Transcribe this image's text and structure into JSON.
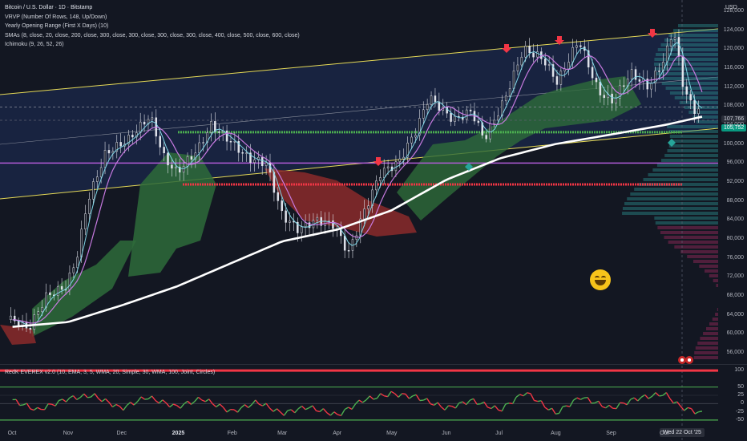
{
  "legend": {
    "title": "Bitcoin / U.S. Dollar · 1D · Bitstamp",
    "vrvp": "VRVP (Number Of Rows, 148, Up/Down)",
    "yearly": "Yearly Opening Range (First X Days) (10)",
    "smas": "SMAs (8, close, 20, close, 200, close, 300, close, 300, close, 300, close, 300, close, 400, close, 500, close, 600, close)",
    "ichimoku": "Ichimoku (9, 26, 52, 26)"
  },
  "currency": "USD",
  "oscillator_legend": "RedK EVEREX v2.0 (10, EMA, 3, 5, WMA, 20, Simple, 30, WMA, 100, Joint, Circles)",
  "price_tags": [
    {
      "value": "107,766",
      "color": "#d1d4dc",
      "bg": "#2a2e39"
    },
    {
      "value": "105,752",
      "color": "#ffffff",
      "bg": "#089981"
    }
  ],
  "date_tag": "Wed 22 Oct '25",
  "x_axis_note": "Nov",
  "colors": {
    "up": "#e0e3eb",
    "down": "#e0e3eb",
    "sma8": "#7fd6e6",
    "sma20": "#c77ae0",
    "sma200": "#ffffff",
    "channel": "#e5d957",
    "cloud_bull": "#2e6b3a",
    "cloud_bear": "#8b2a2a",
    "level_green": "#4caf50",
    "level_red": "#f23645",
    "level_purple": "#b05ad6",
    "osc_line": "#4caf50",
    "osc_red": "#f23645"
  },
  "chart_data": [
    {
      "type": "line",
      "title": "Bitcoin / U.S. Dollar · 1D · Bitstamp",
      "xlabel": "",
      "ylabel": "USD",
      "x_ticks": [
        "Oct",
        "Nov",
        "Dec",
        "2025",
        "Feb",
        "Mar",
        "Apr",
        "May",
        "Jun",
        "Jul",
        "Aug",
        "Sep",
        "Oct"
      ],
      "y_ticks": [
        56000,
        60000,
        64000,
        68000,
        72000,
        76000,
        80000,
        84000,
        88000,
        92000,
        96000,
        100000,
        104000,
        108000,
        112000,
        116000,
        120000,
        124000,
        128000
      ],
      "ylim": [
        54000,
        130000
      ],
      "series": [
        {
          "x": [
            "2024-10-01",
            "2024-10-10",
            "2024-10-20",
            "2024-10-31",
            "2024-11-06",
            "2024-11-12",
            "2024-11-22",
            "2024-12-05",
            "2024-12-17",
            "2024-12-25",
            "2025-01-01",
            "2025-01-13",
            "2025-01-20",
            "2025-01-30",
            "2025-02-10",
            "2025-02-20",
            "2025-03-01",
            "2025-03-10",
            "2025-03-20",
            "2025-03-30",
            "2025-04-07",
            "2025-04-15",
            "2025-04-25",
            "2025-05-05",
            "2025-05-15",
            "2025-05-22",
            "2025-06-05",
            "2025-06-15",
            "2025-06-22",
            "2025-07-03",
            "2025-07-14",
            "2025-07-25",
            "2025-08-02",
            "2025-08-14",
            "2025-08-25",
            "2025-09-02",
            "2025-09-12",
            "2025-09-22",
            "2025-10-01",
            "2025-10-06",
            "2025-10-11",
            "2025-10-17",
            "2025-10-22"
          ],
          "values": [
            63000,
            61000,
            68000,
            70000,
            76000,
            88000,
            98000,
            101000,
            106000,
            97000,
            94000,
            99000,
            104000,
            101000,
            97000,
            96000,
            85000,
            82000,
            84000,
            83000,
            77000,
            85000,
            94000,
            96000,
            103000,
            110000,
            105000,
            107000,
            101000,
            109000,
            120000,
            118000,
            113000,
            122000,
            111000,
            109000,
            115000,
            112000,
            118000,
            124500,
            113000,
            107000,
            107766
          ]
        },
        {
          "x": [
            "2024-10-01",
            "2024-11-01",
            "2024-12-01",
            "2025-01-01",
            "2025-02-01",
            "2025-03-01",
            "2025-04-01",
            "2025-05-01",
            "2025-06-01",
            "2025-07-01",
            "2025-08-01",
            "2025-09-01",
            "2025-10-01",
            "2025-10-22"
          ],
          "values": [
            61500,
            62500,
            66000,
            70000,
            75000,
            79500,
            82000,
            86000,
            92500,
            97000,
            100000,
            102000,
            104000,
            105752
          ]
        }
      ],
      "annotations": [
        "107,766",
        "105,752"
      ]
    },
    {
      "type": "line",
      "title": "RedK EVEREX v2.0 (10, EMA, 3, 5, WMA, 20, Simple, 30, WMA, 100, Joint, Circles)",
      "y_ticks": [
        100,
        50,
        25,
        0,
        -25,
        -50
      ],
      "ylim": [
        -60,
        110
      ],
      "series": [
        {
          "x": [
            "2024-10-01",
            "2024-10-15",
            "2024-11-01",
            "2024-11-15",
            "2024-12-01",
            "2024-12-15",
            "2025-01-01",
            "2025-01-15",
            "2025-02-01",
            "2025-02-15",
            "2025-03-01",
            "2025-03-15",
            "2025-04-01",
            "2025-04-15",
            "2025-05-01",
            "2025-05-15",
            "2025-06-01",
            "2025-06-15",
            "2025-07-01",
            "2025-07-15",
            "2025-08-01",
            "2025-08-15",
            "2025-09-01",
            "2025-09-15",
            "2025-10-01",
            "2025-10-10",
            "2025-10-22"
          ],
          "values": [
            10,
            -20,
            15,
            25,
            -15,
            20,
            -10,
            15,
            -25,
            5,
            -30,
            -10,
            -35,
            10,
            30,
            20,
            -15,
            10,
            -20,
            35,
            -30,
            20,
            -15,
            15,
            30,
            -10,
            -30
          ]
        }
      ]
    }
  ]
}
